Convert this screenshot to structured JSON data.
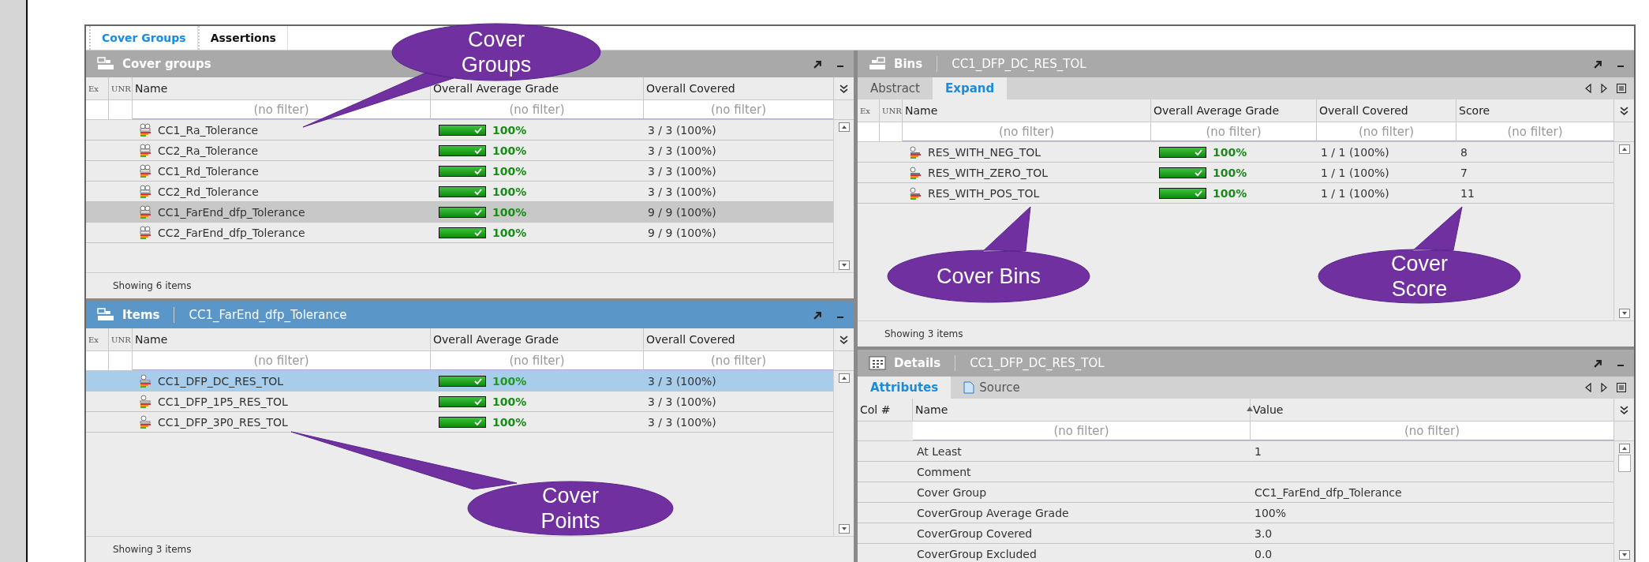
{
  "top_tabs": [
    {
      "label": "Cover Groups",
      "selected": true
    },
    {
      "label": "Assertions",
      "selected": false
    }
  ],
  "cover_groups": {
    "title": "Cover groups",
    "active": false,
    "columns": [
      "Ex",
      "UNR",
      "Name",
      "Overall Average Grade",
      "Overall Covered"
    ],
    "filters": [
      {
        "placeholder": "(no filter)"
      },
      {
        "placeholder": "(no filter)"
      },
      {
        "placeholder": "(no filter)"
      }
    ],
    "rows": [
      {
        "name": "CC1_Ra_Tolerance",
        "level": 1,
        "grade": "100%",
        "covered": "3 / 3 (100%)",
        "selected": false
      },
      {
        "name": "CC2_Ra_Tolerance",
        "level": 1,
        "grade": "100%",
        "covered": "3 / 3 (100%)",
        "selected": false
      },
      {
        "name": "CC1_Rd_Tolerance",
        "level": 1,
        "grade": "100%",
        "covered": "3 / 3 (100%)",
        "selected": false
      },
      {
        "name": "CC2_Rd_Tolerance",
        "level": 1,
        "grade": "100%",
        "covered": "3 / 3 (100%)",
        "selected": false
      },
      {
        "name": "CC1_FarEnd_dfp_Tolerance",
        "level": 1,
        "grade": "100%",
        "covered": "9 / 9 (100%)",
        "selected": true
      },
      {
        "name": "CC2_FarEnd_dfp_Tolerance",
        "level": 1,
        "grade": "100%",
        "covered": "9 / 9 (100%)",
        "selected": false
      }
    ],
    "status": "Showing 6 items"
  },
  "items": {
    "title": "Items",
    "subtitle": "CC1_FarEnd_dfp_Tolerance",
    "active": true,
    "columns": [
      "Ex",
      "UNR",
      "Name",
      "Overall Average Grade",
      "Overall Covered"
    ],
    "filters": [
      {
        "placeholder": "(no filter)"
      },
      {
        "placeholder": "(no filter)"
      },
      {
        "placeholder": "(no filter)"
      }
    ],
    "rows": [
      {
        "name": "CC1_DFP_DC_RES_TOL",
        "level": 1,
        "grade": "100%",
        "covered": "3 / 3 (100%)",
        "selected": true
      },
      {
        "name": "CC1_DFP_1P5_RES_TOL",
        "level": 1,
        "grade": "100%",
        "covered": "3 / 3 (100%)",
        "selected": false
      },
      {
        "name": "CC1_DFP_3P0_RES_TOL",
        "level": 1,
        "grade": "100%",
        "covered": "3 / 3 (100%)",
        "selected": false
      }
    ],
    "status": "Showing 3 items"
  },
  "bins": {
    "title": "Bins",
    "subtitle": "CC1_DFP_DC_RES_TOL",
    "active": false,
    "tabs": [
      {
        "label": "Abstract",
        "selected": false
      },
      {
        "label": "Expand",
        "selected": true
      }
    ],
    "columns": [
      "Ex",
      "UNR",
      "Name",
      "Overall Average Grade",
      "Overall Covered",
      "Score"
    ],
    "filters": [
      {
        "placeholder": "(no filter)"
      },
      {
        "placeholder": "(no filter)"
      },
      {
        "placeholder": "(no filter)"
      },
      {
        "placeholder": "(no filter)"
      }
    ],
    "rows": [
      {
        "name": "RES_WITH_NEG_TOL",
        "level": 1,
        "grade": "100%",
        "covered": "1 / 1 (100%)",
        "score": "8",
        "selected": false
      },
      {
        "name": "RES_WITH_ZERO_TOL",
        "level": 1,
        "grade": "100%",
        "covered": "1 / 1 (100%)",
        "score": "7",
        "selected": false
      },
      {
        "name": "RES_WITH_POS_TOL",
        "level": 1,
        "grade": "100%",
        "covered": "1 / 1 (100%)",
        "score": "11",
        "selected": false
      }
    ],
    "status": "Showing 3 items"
  },
  "details": {
    "title": "Details",
    "subtitle": "CC1_DFP_DC_RES_TOL",
    "active": false,
    "tabs": [
      {
        "label": "Attributes",
        "selected": true
      },
      {
        "label": "Source",
        "selected": false
      }
    ],
    "columns": [
      "Col #",
      "Name",
      "Value"
    ],
    "filters": [
      {
        "placeholder": "(no filter)"
      },
      {
        "placeholder": "(no filter)"
      }
    ],
    "rows": [
      {
        "name": "At Least",
        "value": "1",
        "selected": false
      },
      {
        "name": "Comment",
        "value": "",
        "selected": false
      },
      {
        "name": "Cover Group",
        "value": "CC1_FarEnd_dfp_Tolerance",
        "selected": false
      },
      {
        "name": "CoverGroup Average Grade",
        "value": "100%",
        "selected": false
      },
      {
        "name": "CoverGroup Covered",
        "value": "3.0",
        "selected": false
      },
      {
        "name": "CoverGroup Excluded",
        "value": "0.0",
        "selected": false
      }
    ]
  },
  "callouts": [
    {
      "lines": [
        "Cover",
        "Groups"
      ]
    },
    {
      "lines": [
        "Cover",
        "Points"
      ]
    },
    {
      "lines": [
        "Cover Bins"
      ]
    },
    {
      "lines": [
        "Cover",
        "Score"
      ]
    }
  ]
}
